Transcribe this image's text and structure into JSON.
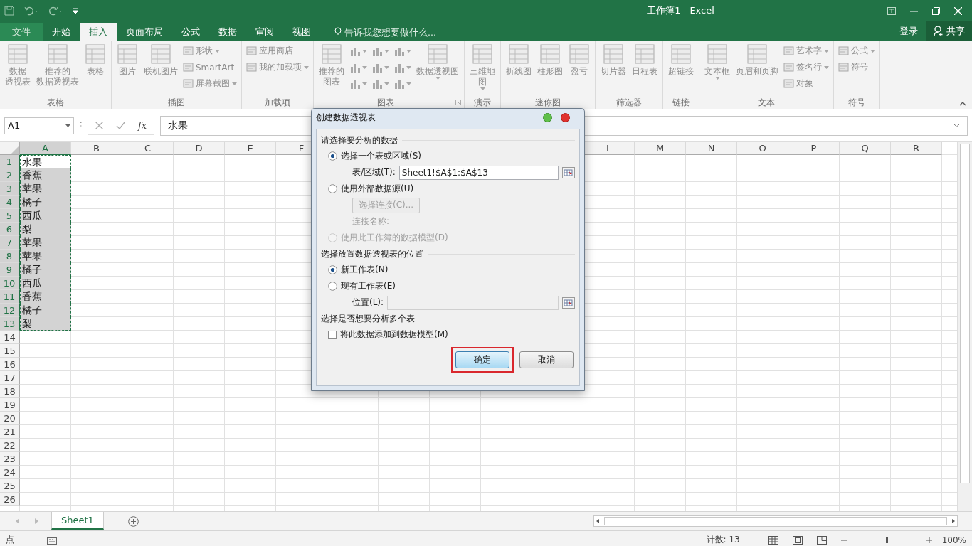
{
  "window": {
    "title": "工作簿1 - Excel"
  },
  "tabs": [
    {
      "label": "文件",
      "kind": "file",
      "selected": false
    },
    {
      "label": "开始",
      "kind": "tab",
      "selected": false
    },
    {
      "label": "插入",
      "kind": "tab",
      "selected": true
    },
    {
      "label": "页面布局",
      "kind": "tab",
      "selected": false
    },
    {
      "label": "公式",
      "kind": "tab",
      "selected": false
    },
    {
      "label": "数据",
      "kind": "tab",
      "selected": false
    },
    {
      "label": "审阅",
      "kind": "tab",
      "selected": false
    },
    {
      "label": "视图",
      "kind": "tab",
      "selected": false
    }
  ],
  "tell_me": {
    "placeholder": "告诉我您想要做什么..."
  },
  "account": {
    "sign_in": "登录",
    "share": "共享"
  },
  "ribbon": {
    "groups": [
      {
        "label": "表格",
        "launcher": false,
        "columns": [
          [
            {
              "kind": "large",
              "lines": [
                "数据",
                "透视表"
              ],
              "dropdown": false
            }
          ],
          [
            {
              "kind": "large",
              "lines": [
                "推荐的",
                "数据透视表"
              ],
              "dropdown": false
            }
          ],
          [
            {
              "kind": "large",
              "lines": [
                "表格"
              ],
              "dropdown": false
            }
          ]
        ]
      },
      {
        "label": "插图",
        "launcher": false,
        "columns": [
          [
            {
              "kind": "large",
              "lines": [
                "图片"
              ],
              "dropdown": false
            }
          ],
          [
            {
              "kind": "large",
              "lines": [
                "联机图片"
              ],
              "dropdown": false
            }
          ],
          [
            {
              "kind": "small",
              "label": "形状",
              "dropdown": true
            },
            {
              "kind": "small",
              "label": "SmartArt",
              "dropdown": false
            },
            {
              "kind": "small",
              "label": "屏幕截图",
              "dropdown": true
            }
          ]
        ]
      },
      {
        "label": "加载项",
        "launcher": false,
        "columns": [
          [
            {
              "kind": "small",
              "label": "应用商店",
              "dropdown": false
            },
            {
              "kind": "small",
              "label": "我的加载项",
              "dropdown": true
            }
          ]
        ]
      },
      {
        "label": "图表",
        "launcher": true,
        "columns": [
          [
            {
              "kind": "large",
              "lines": [
                "推荐的",
                "图表"
              ],
              "dropdown": false
            }
          ],
          [
            {
              "kind": "chart",
              "dropdown": true
            },
            {
              "kind": "chart",
              "dropdown": true
            },
            {
              "kind": "chart",
              "dropdown": true
            }
          ],
          [
            {
              "kind": "chart",
              "dropdown": true
            },
            {
              "kind": "chart",
              "dropdown": true
            },
            {
              "kind": "chart",
              "dropdown": true
            }
          ],
          [
            {
              "kind": "chart",
              "dropdown": true
            },
            {
              "kind": "chart",
              "dropdown": true
            },
            {
              "kind": "chart",
              "dropdown": true
            }
          ],
          [
            {
              "kind": "large",
              "lines": [
                "数据透视图"
              ],
              "dropdown": true
            }
          ]
        ]
      },
      {
        "label": "演示",
        "launcher": false,
        "columns": [
          [
            {
              "kind": "large",
              "lines": [
                "三维地",
                "图"
              ],
              "dropdown": true
            }
          ]
        ]
      },
      {
        "label": "迷你图",
        "launcher": false,
        "columns": [
          [
            {
              "kind": "large",
              "lines": [
                "折线图"
              ],
              "dropdown": false
            }
          ],
          [
            {
              "kind": "large",
              "lines": [
                "柱形图"
              ],
              "dropdown": false
            }
          ],
          [
            {
              "kind": "large",
              "lines": [
                "盈亏"
              ],
              "dropdown": false
            }
          ]
        ]
      },
      {
        "label": "筛选器",
        "launcher": false,
        "columns": [
          [
            {
              "kind": "large",
              "lines": [
                "切片器"
              ],
              "dropdown": false
            }
          ],
          [
            {
              "kind": "large",
              "lines": [
                "日程表"
              ],
              "dropdown": false
            }
          ]
        ]
      },
      {
        "label": "链接",
        "launcher": false,
        "columns": [
          [
            {
              "kind": "large",
              "lines": [
                "超链接"
              ],
              "dropdown": false
            }
          ]
        ]
      },
      {
        "label": "文本",
        "launcher": false,
        "columns": [
          [
            {
              "kind": "large",
              "lines": [
                "文本框"
              ],
              "dropdown": true
            }
          ],
          [
            {
              "kind": "large",
              "lines": [
                "页眉和页脚"
              ],
              "dropdown": false
            }
          ],
          [
            {
              "kind": "small",
              "label": "艺术字",
              "dropdown": true
            },
            {
              "kind": "small",
              "label": "签名行",
              "dropdown": true
            },
            {
              "kind": "small",
              "label": "对象",
              "dropdown": false
            }
          ]
        ]
      },
      {
        "label": "符号",
        "launcher": false,
        "columns": [
          [
            {
              "kind": "small",
              "label": "公式",
              "dropdown": true
            },
            {
              "kind": "small",
              "label": "符号",
              "dropdown": false
            }
          ]
        ]
      }
    ]
  },
  "formula_bar": {
    "name_box": "A1",
    "fx": "fx",
    "value": "水果"
  },
  "grid": {
    "columns_left": [
      {
        "label": "A",
        "selected": true
      },
      {
        "label": "B",
        "selected": false
      },
      {
        "label": "C",
        "selected": false
      },
      {
        "label": "D",
        "selected": false
      },
      {
        "label": "E",
        "selected": false
      },
      {
        "label": "F",
        "selected": false
      }
    ],
    "columns_right": [
      {
        "label": "L",
        "selected": false
      },
      {
        "label": "M",
        "selected": false
      },
      {
        "label": "N",
        "selected": false
      },
      {
        "label": "O",
        "selected": false
      },
      {
        "label": "P",
        "selected": false
      },
      {
        "label": "Q",
        "selected": false
      },
      {
        "label": "R",
        "selected": false
      }
    ],
    "rows": [
      {
        "label": "1",
        "selected": true,
        "active": true,
        "value": "水果"
      },
      {
        "label": "2",
        "selected": true,
        "active": false,
        "value": "香蕉"
      },
      {
        "label": "3",
        "selected": true,
        "active": false,
        "value": "苹果"
      },
      {
        "label": "4",
        "selected": true,
        "active": false,
        "value": "橘子"
      },
      {
        "label": "5",
        "selected": true,
        "active": false,
        "value": "西瓜"
      },
      {
        "label": "6",
        "selected": true,
        "active": false,
        "value": "梨"
      },
      {
        "label": "7",
        "selected": true,
        "active": false,
        "value": "苹果"
      },
      {
        "label": "8",
        "selected": true,
        "active": false,
        "value": "苹果"
      },
      {
        "label": "9",
        "selected": true,
        "active": false,
        "value": "橘子"
      },
      {
        "label": "10",
        "selected": true,
        "active": false,
        "value": "西瓜"
      },
      {
        "label": "11",
        "selected": true,
        "active": false,
        "value": "香蕉"
      },
      {
        "label": "12",
        "selected": true,
        "active": false,
        "value": "橘子"
      },
      {
        "label": "13",
        "selected": true,
        "active": false,
        "value": "梨"
      },
      {
        "label": "14",
        "selected": false,
        "active": false
      },
      {
        "label": "15",
        "selected": false,
        "active": false
      },
      {
        "label": "16",
        "selected": false,
        "active": false
      },
      {
        "label": "17",
        "selected": false,
        "active": false
      },
      {
        "label": "18",
        "selected": false,
        "active": false
      },
      {
        "label": "19",
        "selected": false,
        "active": false
      },
      {
        "label": "20",
        "selected": false,
        "active": false
      },
      {
        "label": "21",
        "selected": false,
        "active": false
      },
      {
        "label": "22",
        "selected": false,
        "active": false
      },
      {
        "label": "23",
        "selected": false,
        "active": false
      },
      {
        "label": "24",
        "selected": false,
        "active": false
      },
      {
        "label": "25",
        "selected": false,
        "active": false
      },
      {
        "label": "26",
        "selected": false,
        "active": false
      }
    ]
  },
  "sheet_tabs": [
    {
      "label": "Sheet1",
      "selected": true
    }
  ],
  "status_bar": {
    "mode": "点",
    "count": "计数: 13",
    "zoom": {
      "level": 0.5,
      "label": "100%"
    }
  },
  "dialog": {
    "title": "创建数据透视表",
    "sections": [
      {
        "heading": "请选择要分析的数据",
        "items": [
          {
            "kind": "radio",
            "label": "选择一个表或区域(S)",
            "selected": true,
            "disabled": false
          },
          {
            "kind": "field",
            "label": "表/区域(T):",
            "value": "Sheet1!$A$1:$A$13",
            "disabled": false
          },
          {
            "kind": "radio",
            "label": "使用外部数据源(U)",
            "selected": false,
            "disabled": false
          },
          {
            "kind": "button",
            "label": "选择连接(C)...",
            "disabled": true
          },
          {
            "kind": "text",
            "label": "连接名称:",
            "disabled": true
          },
          {
            "kind": "radio",
            "label": "使用此工作簿的数据模型(D)",
            "selected": false,
            "disabled": true
          }
        ]
      },
      {
        "heading": "选择放置数据透视表的位置",
        "items": [
          {
            "kind": "radio",
            "label": "新工作表(N)",
            "selected": true,
            "disabled": false
          },
          {
            "kind": "radio",
            "label": "现有工作表(E)",
            "selected": false,
            "disabled": false
          },
          {
            "kind": "field",
            "label": "位置(L):",
            "disabled": true
          }
        ]
      },
      {
        "heading": "选择是否想要分析多个表",
        "items": [
          {
            "kind": "checkbox",
            "label": "将此数据添加到数据模型(M)",
            "checked": false,
            "disabled": false
          }
        ]
      }
    ],
    "buttons": [
      {
        "label": "确定",
        "kind": "primary",
        "highlighted": true
      },
      {
        "label": "取消",
        "kind": "normal",
        "highlighted": false
      }
    ]
  }
}
